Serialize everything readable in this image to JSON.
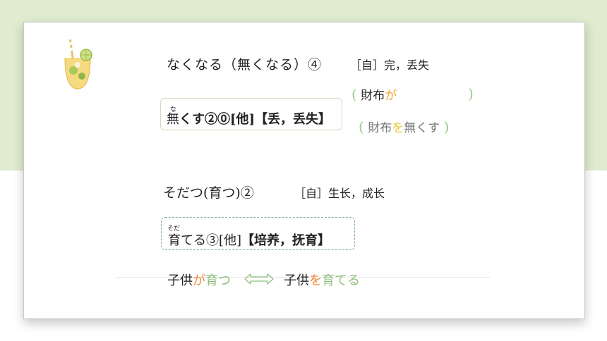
{
  "colors": {
    "top_band": "#dfeccf",
    "paren_green": "#9bc98a",
    "particle_orange": "#f08a3c",
    "particle_yellow": "#f0c840",
    "verb_green": "#8cbf7a"
  },
  "icons": {
    "decoration": "iced-lemon-drink-icon",
    "arrow": "double-arrow-icon"
  },
  "entry1": {
    "word": "なくなる（無くなる）④",
    "meaning": "［自］完，丢失"
  },
  "entry1_transitive": {
    "ruby": "な",
    "kanji": "無",
    "rest": "くす②⓪[他]【丢，丢失】"
  },
  "example1": {
    "open": "(",
    "noun": "財布",
    "particle": "が",
    "close": ")"
  },
  "example2": {
    "open": "(",
    "noun": "財布",
    "particle": "を",
    "verb": "無くす",
    "close": ")"
  },
  "entry2": {
    "word": "そだつ(育つ)②",
    "meaning": "［自］生长，成长"
  },
  "entry2_transitive": {
    "ruby": "そだ",
    "kanji": "育",
    "rest_light": "てる③[他]",
    "rest_bold": "【培养，抚育】"
  },
  "example3": {
    "noun": "子供",
    "particle": "が",
    "verb": "育つ"
  },
  "example4": {
    "noun": "子供",
    "particle": "を",
    "verb": "育てる"
  }
}
